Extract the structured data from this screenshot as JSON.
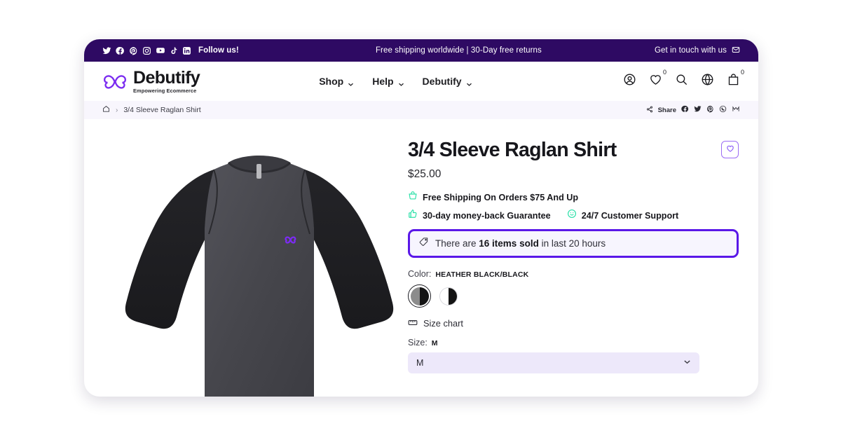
{
  "announcement": {
    "social_icons": [
      "twitter-icon",
      "facebook-icon",
      "pinterest-icon",
      "instagram-icon",
      "youtube-icon",
      "tiktok-icon",
      "linkedin-icon"
    ],
    "follow_text": "Follow us!",
    "center_text": "Free shipping worldwide | 30-Day free returns",
    "contact_text": "Get in touch with us",
    "contact_icon": "envelope-icon",
    "bg_color": "#2E0A63"
  },
  "header": {
    "brand_name": "Debutify",
    "brand_tagline": "Empowering Ecommerce",
    "brand_icon": "butterfly-logo-icon",
    "brand_color": "#7B2CF0",
    "nav": [
      {
        "label": "Shop",
        "icon": "chevron-down-icon"
      },
      {
        "label": "Help",
        "icon": "chevron-down-icon"
      },
      {
        "label": "Debutify",
        "icon": "chevron-down-icon"
      }
    ],
    "icons": [
      {
        "name": "account-icon",
        "badge": ""
      },
      {
        "name": "wishlist-heart-icon",
        "badge": "0"
      },
      {
        "name": "search-icon",
        "badge": ""
      },
      {
        "name": "globe-language-icon",
        "badge": ""
      },
      {
        "name": "cart-bag-icon",
        "badge": "0"
      }
    ]
  },
  "breadcrumb": {
    "home_icon": "home-icon",
    "separator": "›",
    "current": "3/4 Sleeve Raglan Shirt",
    "share_label": "Share",
    "share_icon": "share-icon",
    "share_targets": [
      "facebook-icon",
      "twitter-icon",
      "pinterest-icon",
      "whatsapp-icon",
      "mail-icon"
    ]
  },
  "product": {
    "image_alt": "3/4 sleeve raglan shirt, heather black body with black sleeves and purple butterfly logo",
    "title": "3/4 Sleeve Raglan Shirt",
    "price": "$25.00",
    "wishlist_icon": "heart-outline-icon",
    "trust_badges": [
      {
        "icon": "basket-icon",
        "text": "Free Shipping On Orders $75 And Up",
        "color": "#2BE0A8"
      },
      {
        "icon": "thumbs-up-icon",
        "text": "30-day money-back Guarantee",
        "color": "#2BE0A8"
      },
      {
        "icon": "support-smile-icon",
        "text": "24/7 Customer Support",
        "color": "#2BE0A8"
      }
    ],
    "sold_notice": {
      "icon": "tag-icon",
      "prefix": "There are ",
      "highlight": "16 items sold",
      "suffix": " in last 20 hours",
      "border_color": "#5A18E8",
      "bg_color": "#F7F5FE"
    },
    "color": {
      "label": "Color:",
      "selected": "HEATHER BLACK/BLACK",
      "swatches": [
        {
          "name": "heather-black-black",
          "left": "#8C8C8C",
          "right": "#141414",
          "selected": true
        },
        {
          "name": "white-black",
          "left": "#FFFFFF",
          "right": "#141414",
          "selected": false
        }
      ]
    },
    "size_chart": {
      "icon": "ruler-icon",
      "label": "Size chart"
    },
    "size": {
      "label": "Size:",
      "selected": "M",
      "dropdown_value": "M",
      "dropdown_icon": "chevron-down-icon",
      "options": [
        "M"
      ]
    }
  }
}
